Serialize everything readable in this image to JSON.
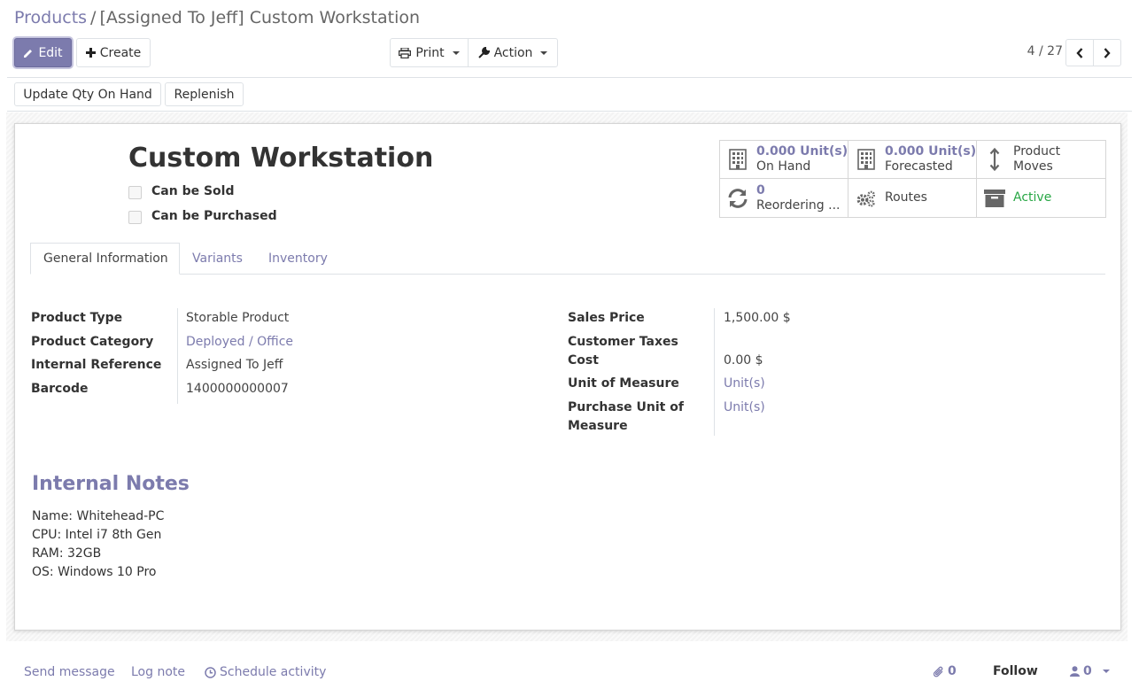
{
  "breadcrumb": {
    "parent": "Products",
    "separator": "/",
    "current": "[Assigned To Jeff] Custom Workstation"
  },
  "toolbar": {
    "edit_label": "Edit",
    "create_label": "Create",
    "print_label": "Print",
    "action_label": "Action"
  },
  "pager": {
    "value": "4 / 27"
  },
  "header_buttons": {
    "update_qty": "Update Qty On Hand",
    "replenish": "Replenish"
  },
  "product": {
    "name": "Custom Workstation",
    "can_be_sold_label": "Can be Sold",
    "can_be_purchased_label": "Can be Purchased",
    "can_be_sold": false,
    "can_be_purchased": false
  },
  "stats": {
    "on_hand": {
      "value": "0.000 Unit(s)",
      "label": "On Hand"
    },
    "forecasted": {
      "value": "0.000 Unit(s)",
      "label": "Forecasted"
    },
    "moves": {
      "line1": "Product",
      "line2": "Moves"
    },
    "reordering": {
      "value": "0",
      "label": "Reordering ..."
    },
    "routes": {
      "label": "Routes"
    },
    "active": {
      "label": "Active",
      "color": "#28a745"
    }
  },
  "tabs": [
    {
      "label": "General Information",
      "active": true
    },
    {
      "label": "Variants",
      "active": false
    },
    {
      "label": "Inventory",
      "active": false
    }
  ],
  "fields_left": [
    {
      "label": "Product Type",
      "value": "Storable Product"
    },
    {
      "label": "Product Category",
      "value": "Deployed / Office"
    },
    {
      "label": "Internal Reference",
      "value": "Assigned To Jeff"
    },
    {
      "label": "Barcode",
      "value": "1400000000007"
    }
  ],
  "fields_right": {
    "sales_price": {
      "label": "Sales Price",
      "value": "1,500.00 $"
    },
    "customer_taxes": {
      "label": "Customer Taxes",
      "value": ""
    },
    "cost": {
      "label": "Cost",
      "value": "0.00 $"
    },
    "uom": {
      "label": "Unit of Measure",
      "value": "Unit(s)"
    },
    "purchase_uom": {
      "label_line1": "Purchase Unit of",
      "label_line2": "Measure",
      "value": "Unit(s)"
    }
  },
  "notes": {
    "title": "Internal Notes",
    "body": "Name: Whitehead-PC\nCPU: Intel i7 8th Gen\nRAM: 32GB\nOS: Windows 10 Pro"
  },
  "chatter": {
    "send_message": "Send message",
    "log_note": "Log note",
    "schedule_activity": "Schedule activity",
    "attachments_count": "0",
    "follow": "Follow",
    "followers_count": "0"
  },
  "colors": {
    "brand": "#7c7bad",
    "active": "#28a745"
  },
  "icons": [
    "pencil-icon",
    "plus-icon",
    "print-icon",
    "wrench-icon",
    "chevron-left-icon",
    "chevron-right-icon",
    "building-icon",
    "arrows-v-icon",
    "refresh-icon",
    "cogs-icon",
    "archive-icon",
    "clock-icon",
    "paperclip-icon",
    "user-icon"
  ]
}
